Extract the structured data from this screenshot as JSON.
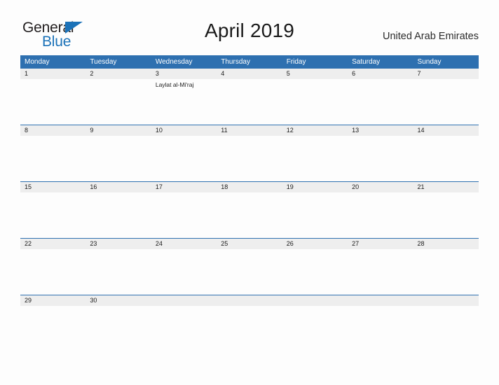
{
  "brand": {
    "name_part1": "General",
    "name_part2": "Blue",
    "triangle_icon": "triangle-icon",
    "color_dark": "#231f20",
    "color_blue": "#1b72b8"
  },
  "header": {
    "title": "April 2019",
    "country": "United Arab Emirates"
  },
  "theme": {
    "header_blue": "#2e70b0",
    "daynum_band": "#eeeeee",
    "page_bg": "#fdfdfd",
    "rule_blue": "#2e70b0"
  },
  "calendar": {
    "weekday_headers": [
      "Monday",
      "Tuesday",
      "Wednesday",
      "Thursday",
      "Friday",
      "Saturday",
      "Sunday"
    ],
    "weeks": [
      {
        "days": [
          {
            "num": "1",
            "events": []
          },
          {
            "num": "2",
            "events": []
          },
          {
            "num": "3",
            "events": [
              "Laylat al-Mi'raj"
            ]
          },
          {
            "num": "4",
            "events": []
          },
          {
            "num": "5",
            "events": []
          },
          {
            "num": "6",
            "events": []
          },
          {
            "num": "7",
            "events": []
          }
        ]
      },
      {
        "days": [
          {
            "num": "8",
            "events": []
          },
          {
            "num": "9",
            "events": []
          },
          {
            "num": "10",
            "events": []
          },
          {
            "num": "11",
            "events": []
          },
          {
            "num": "12",
            "events": []
          },
          {
            "num": "13",
            "events": []
          },
          {
            "num": "14",
            "events": []
          }
        ]
      },
      {
        "days": [
          {
            "num": "15",
            "events": []
          },
          {
            "num": "16",
            "events": []
          },
          {
            "num": "17",
            "events": []
          },
          {
            "num": "18",
            "events": []
          },
          {
            "num": "19",
            "events": []
          },
          {
            "num": "20",
            "events": []
          },
          {
            "num": "21",
            "events": []
          }
        ]
      },
      {
        "days": [
          {
            "num": "22",
            "events": []
          },
          {
            "num": "23",
            "events": []
          },
          {
            "num": "24",
            "events": []
          },
          {
            "num": "25",
            "events": []
          },
          {
            "num": "26",
            "events": []
          },
          {
            "num": "27",
            "events": []
          },
          {
            "num": "28",
            "events": []
          }
        ]
      },
      {
        "days": [
          {
            "num": "29",
            "events": []
          },
          {
            "num": "30",
            "events": []
          },
          {
            "num": "",
            "events": []
          },
          {
            "num": "",
            "events": []
          },
          {
            "num": "",
            "events": []
          },
          {
            "num": "",
            "events": []
          },
          {
            "num": "",
            "events": []
          }
        ]
      }
    ]
  }
}
